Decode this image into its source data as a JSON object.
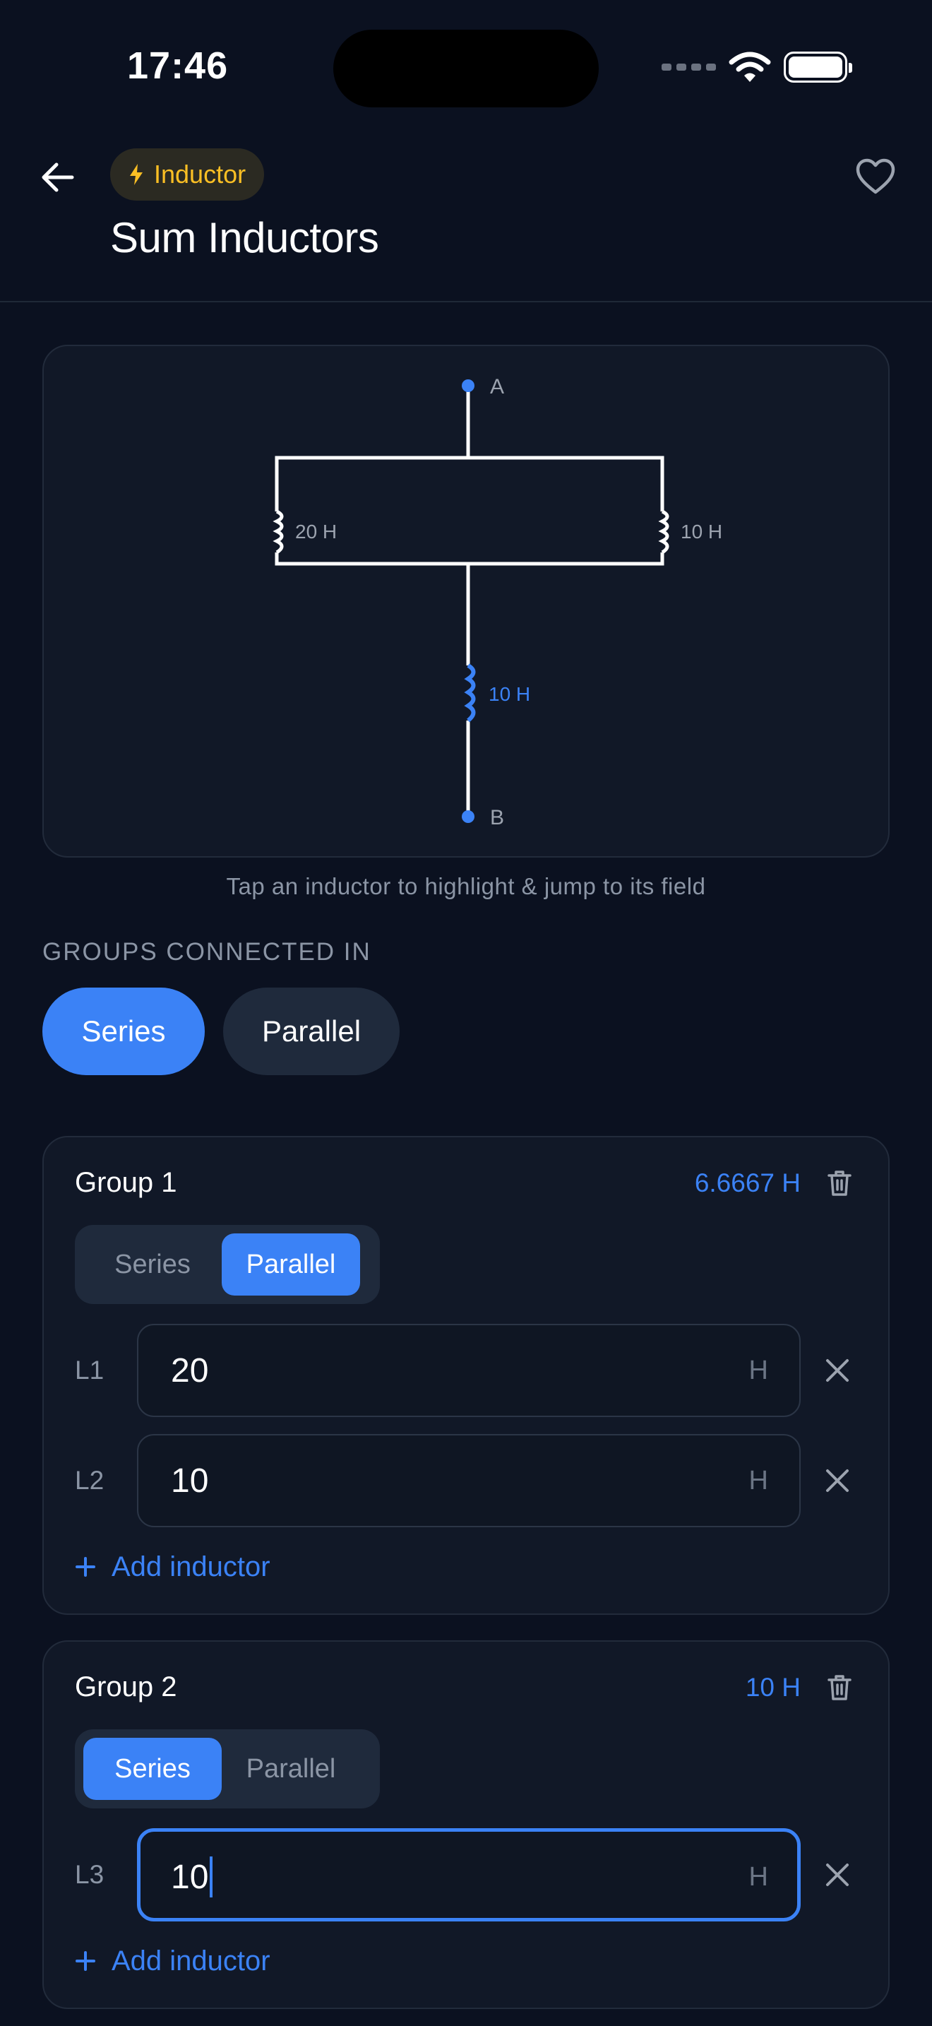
{
  "status_bar": {
    "time": "17:46"
  },
  "header": {
    "category_icon": "bolt-icon",
    "category_label": "Inductor",
    "title": "Sum Inductors",
    "back_icon": "arrow-left-icon",
    "favorite_icon": "heart-icon"
  },
  "diagram": {
    "node_top": "A",
    "node_bottom": "B",
    "inductors": [
      {
        "label": "20 H",
        "highlighted": false
      },
      {
        "label": "10 H",
        "highlighted": false
      },
      {
        "label": "10 H",
        "highlighted": true
      }
    ],
    "hint": "Tap an inductor to highlight & jump to its field"
  },
  "connection": {
    "label": "GROUPS CONNECTED IN",
    "options": [
      "Series",
      "Parallel"
    ],
    "selected": "Series"
  },
  "groups": [
    {
      "title": "Group 1",
      "total": "6.6667 H",
      "mode_options": [
        "Series",
        "Parallel"
      ],
      "mode": "Parallel",
      "inductors": [
        {
          "label": "L1",
          "value": "20",
          "unit": "H"
        },
        {
          "label": "L2",
          "value": "10",
          "unit": "H"
        }
      ],
      "add_label": "Add inductor"
    },
    {
      "title": "Group 2",
      "total": "10 H",
      "mode_options": [
        "Series",
        "Parallel"
      ],
      "mode": "Series",
      "inductors": [
        {
          "label": "L3",
          "value": "10",
          "unit": "H",
          "focused": true
        }
      ],
      "add_label": "Add inductor"
    }
  ],
  "colors": {
    "background": "#0b1120",
    "card": "#111827",
    "accent": "#3b82f6",
    "category": "#fbbf24",
    "muted": "#8b95a5"
  }
}
